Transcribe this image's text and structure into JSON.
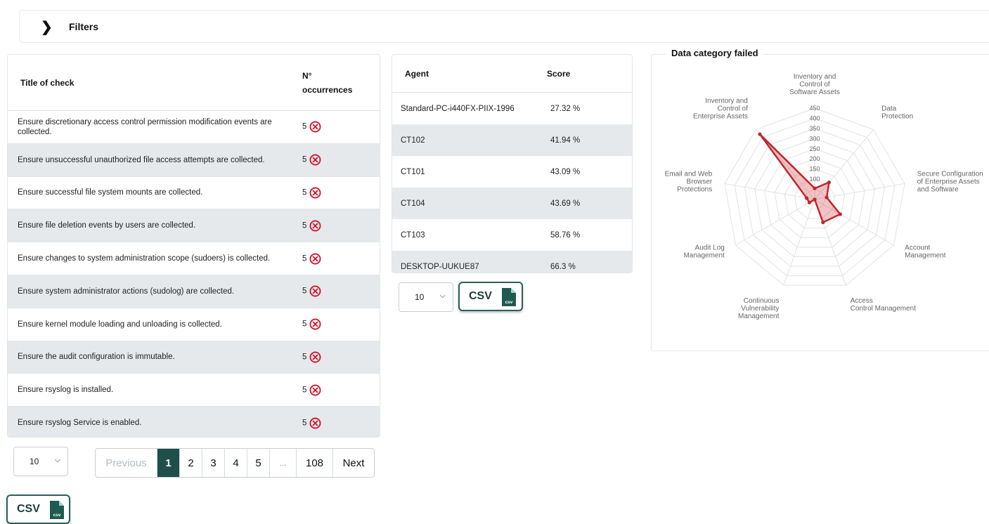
{
  "filters": {
    "title": "Filters"
  },
  "checks": {
    "col_title": "Title of check",
    "col_occ_1": "N°",
    "col_occ_2": "occurrences",
    "rows": [
      {
        "title": "Ensure discretionary access control permission modification events are collected.",
        "count": "5"
      },
      {
        "title": "Ensure unsuccessful unauthorized file access attempts are collected.",
        "count": "5"
      },
      {
        "title": "Ensure successful file system mounts are collected.",
        "count": "5"
      },
      {
        "title": "Ensure file deletion events by users are collected.",
        "count": "5"
      },
      {
        "title": "Ensure changes to system administration scope (sudoers) is collected.",
        "count": "5"
      },
      {
        "title": "Ensure system administrator actions (sudolog) are collected.",
        "count": "5"
      },
      {
        "title": "Ensure kernel module loading and unloading is collected.",
        "count": "5"
      },
      {
        "title": "Ensure the audit configuration is immutable.",
        "count": "5"
      },
      {
        "title": "Ensure rsyslog is installed.",
        "count": "5"
      },
      {
        "title": "Ensure rsyslog Service is enabled.",
        "count": "5"
      }
    ],
    "page_size": "10",
    "pagination": {
      "previous": "Previous",
      "pages": [
        "1",
        "2",
        "3",
        "4",
        "5"
      ],
      "ellipsis": "...",
      "last": "108",
      "next": "Next"
    },
    "csv_label": "CSV"
  },
  "agents": {
    "col_agent": "Agent",
    "col_score": "Score",
    "rows": [
      {
        "agent": "Standard-PC-i440FX-PIIX-1996",
        "score": "27.32 %"
      },
      {
        "agent": "CT102",
        "score": "41.94 %"
      },
      {
        "agent": "CT101",
        "score": "43.09 %"
      },
      {
        "agent": "CT104",
        "score": "43.69 %"
      },
      {
        "agent": "CT103",
        "score": "58.76 %"
      },
      {
        "agent": "DESKTOP-UUKUE87",
        "score": "66.3 %"
      }
    ],
    "page_size": "10",
    "csv_label": "CSV"
  },
  "colors": {
    "accent": "#1f4f4a",
    "error": "#d0162c",
    "radar": "#c0262c"
  },
  "chart_data": {
    "type": "radar",
    "title": "Data category failed",
    "categories": [
      "Inventory and Control of Software Assets",
      "Data Protection",
      "Secure Configuration of Enterprise Assets and Software",
      "Account Management",
      "Access Control Management",
      "Continuous Vulnerability Management",
      "Audit Log Management",
      "Email and Web Browser Protections",
      "Inventory and Control of Enterprise Assets"
    ],
    "ticks": [
      "100",
      "150",
      "200",
      "250",
      "300",
      "350",
      "400",
      "450"
    ],
    "rmax": 450,
    "values": [
      55,
      110,
      60,
      145,
      120,
      0,
      30,
      40,
      420
    ],
    "grid": true
  }
}
